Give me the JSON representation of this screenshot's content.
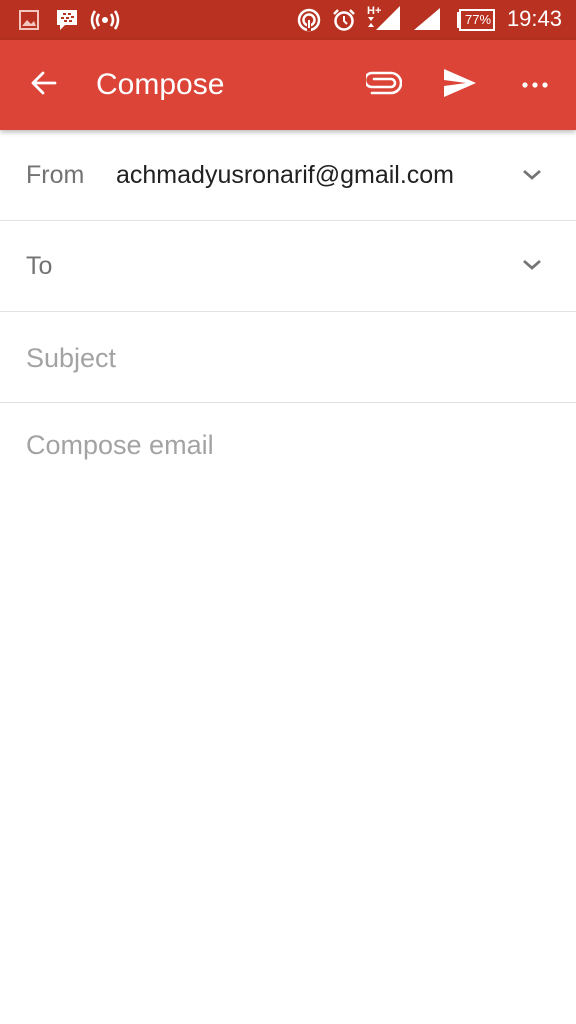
{
  "status_bar": {
    "icons": [
      "gallery-icon",
      "bbm-icon",
      "hotspot-icon",
      "nfc-icon",
      "alarm-icon",
      "signal-hplus-icon",
      "signal-icon",
      "battery-icon"
    ],
    "network_type": "H+",
    "battery_percent": "77%",
    "time": "19:43"
  },
  "app_bar": {
    "title": "Compose",
    "back_icon": "arrow-left-icon",
    "attach_icon": "paperclip-icon",
    "send_icon": "send-icon",
    "more_icon": "more-horizontal-icon"
  },
  "form": {
    "from": {
      "label": "From",
      "value": "achmadyusronarif@gmail.com"
    },
    "to": {
      "label": "To",
      "value": ""
    },
    "subject": {
      "placeholder": "Subject",
      "value": ""
    },
    "body": {
      "placeholder": "Compose email",
      "value": ""
    }
  },
  "colors": {
    "status_bar": "#b93221",
    "app_bar": "#db4437"
  }
}
